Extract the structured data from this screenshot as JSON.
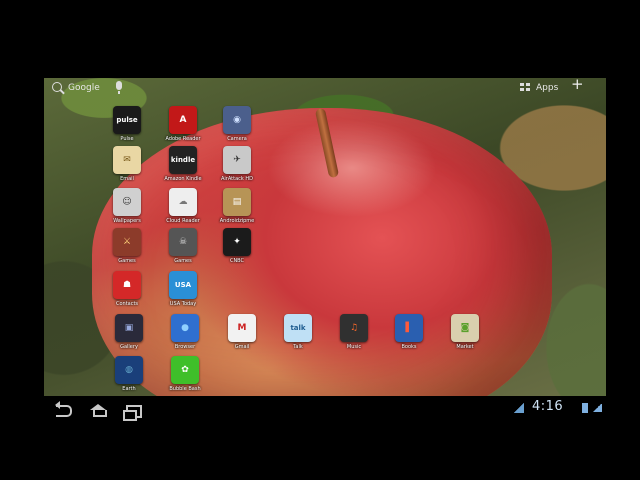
{
  "status_bar": {
    "search_label": "Google",
    "apps_label": "Apps",
    "add_label": "+"
  },
  "icons": [
    {
      "label": "Pulse",
      "glyph": "pulse",
      "bg": "#1a1a1a",
      "fg": "#ffffff"
    },
    {
      "label": "Adobe Reader",
      "glyph": "A",
      "bg": "#c21818",
      "fg": "#ffffff"
    },
    {
      "label": "Camera",
      "glyph": "◉",
      "bg": "#4b5f8c",
      "fg": "#cfe0ff"
    },
    {
      "label": "Email",
      "glyph": "✉",
      "bg": "#e9d7a4",
      "fg": "#7a5a1a"
    },
    {
      "label": "Amazon Kindle",
      "glyph": "kindle",
      "bg": "#222222",
      "fg": "#ffffff"
    },
    {
      "label": "AirAttack HD",
      "glyph": "✈",
      "bg": "#c9c9c9",
      "fg": "#333333"
    },
    {
      "label": "Wallpapers",
      "glyph": "☺",
      "bg": "#d0d0d0",
      "fg": "#333333"
    },
    {
      "label": "Cloud Reader",
      "glyph": "☁",
      "bg": "#eeeeee",
      "fg": "#777777"
    },
    {
      "label": "Androidzipme",
      "glyph": "▤",
      "bg": "#b79456",
      "fg": "#ffffff"
    },
    {
      "label": "Games",
      "glyph": "⚔",
      "bg": "#8c3b2a",
      "fg": "#ffd27a"
    },
    {
      "label": "Games",
      "glyph": "☠",
      "bg": "#555555",
      "fg": "#dddddd"
    },
    {
      "label": "CNBC",
      "glyph": "✦",
      "bg": "#1b1b1b",
      "fg": "#ffffff"
    },
    {
      "label": "Contacts",
      "glyph": "☗",
      "bg": "#d42828",
      "fg": "#ffffff"
    },
    {
      "label": "USA Today",
      "glyph": "USA",
      "bg": "#2a8fd6",
      "fg": "#ffffff"
    },
    {
      "label": "Gallery",
      "glyph": "▣",
      "bg": "#2a2a3a",
      "fg": "#9ad"
    },
    {
      "label": "Browser",
      "glyph": "●",
      "bg": "#2f6fcf",
      "fg": "#8fd0ff"
    },
    {
      "label": "Gmail",
      "glyph": "M",
      "bg": "#f2f2f2",
      "fg": "#c22"
    },
    {
      "label": "Talk",
      "glyph": "talk",
      "bg": "#bfe0f5",
      "fg": "#1e5d90"
    },
    {
      "label": "Music",
      "glyph": "♫",
      "bg": "#303030",
      "fg": "#ff6a2a"
    },
    {
      "label": "Books",
      "glyph": "▌",
      "bg": "#2a5fb0",
      "fg": "#ff5a3a"
    },
    {
      "label": "Market",
      "glyph": "◙",
      "bg": "#d9cfae",
      "fg": "#5aa02c"
    },
    {
      "label": "Earth",
      "glyph": "◍",
      "bg": "#1a3f7a",
      "fg": "#6ac"
    },
    {
      "label": "Bubble Bash",
      "glyph": "✿",
      "bg": "#3fbf2a",
      "fg": "#ffffff"
    }
  ],
  "nav_bar": {
    "clock": "4:16"
  },
  "colors": {
    "screen_bg": "#000000",
    "clock": "#cfe3f5"
  }
}
